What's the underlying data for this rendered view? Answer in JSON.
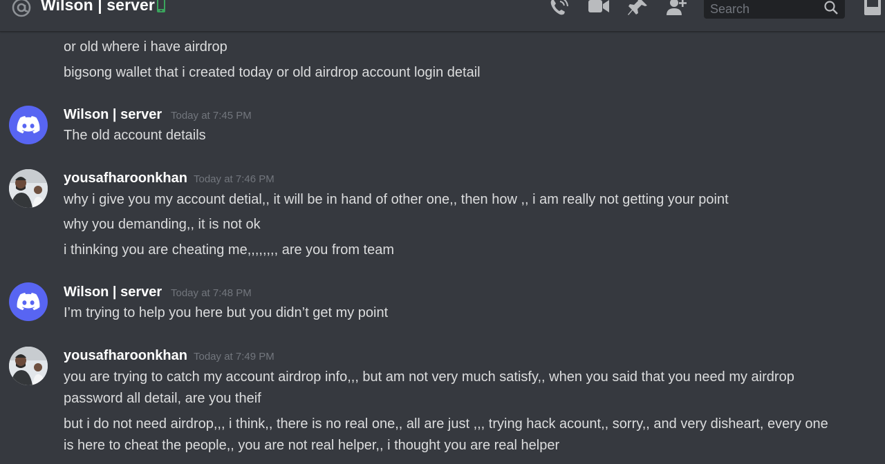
{
  "header": {
    "dm_title": "Wilson | server",
    "icons": [
      "at-icon",
      "mobile-status-icon",
      "voice-call-icon",
      "video-call-icon",
      "pin-icon",
      "add-friend-icon",
      "search-icon",
      "inbox-icon"
    ],
    "search_placeholder": "Search",
    "status_color": "#3ba55d"
  },
  "colors": {
    "background": "#36393f",
    "blurple": "#5865f2",
    "text": "#dcddde",
    "muted": "#72767d"
  },
  "messages": [
    {
      "continuation": true,
      "lines": [
        "or old where i have airdrop",
        "bigsong wallet that i created today or old airdrop account login detail"
      ]
    },
    {
      "author": "Wilson | server",
      "timestamp": "Today at 7:45 PM",
      "avatar": "discord-logo-icon",
      "lines": [
        "The old account details"
      ]
    },
    {
      "author": "yousafharoonkhan",
      "timestamp": "Today at 7:46 PM",
      "avatar": "user-photo",
      "lines": [
        "why i give you my account detial,, it  will be in hand of other one,, then how ,, i am really not getting your point",
        "why you demanding,, it is not ok",
        "i thinking you are cheating me,,,,,,,, are you from team"
      ]
    },
    {
      "author": "Wilson | server",
      "timestamp": "Today at 7:48 PM",
      "avatar": "discord-logo-icon",
      "lines": [
        "I’m trying to help you here but you didn’t get my point"
      ]
    },
    {
      "author": "yousafharoonkhan",
      "timestamp": "Today at 7:49 PM",
      "avatar": "user-photo",
      "lines": [
        "you are trying to catch my account airdrop info,,, but  am not very much satisfy,, when you said that you need my airdrop",
        "password all detail, are you theif",
        "but i do not need airdrop,,, i think,, there is no real one,, all are just ,,, trying hack acount,, sorry,, and very disheart, every one",
        "is here to cheat the people,, you are not real helper,, i thought you are real helper"
      ]
    }
  ]
}
